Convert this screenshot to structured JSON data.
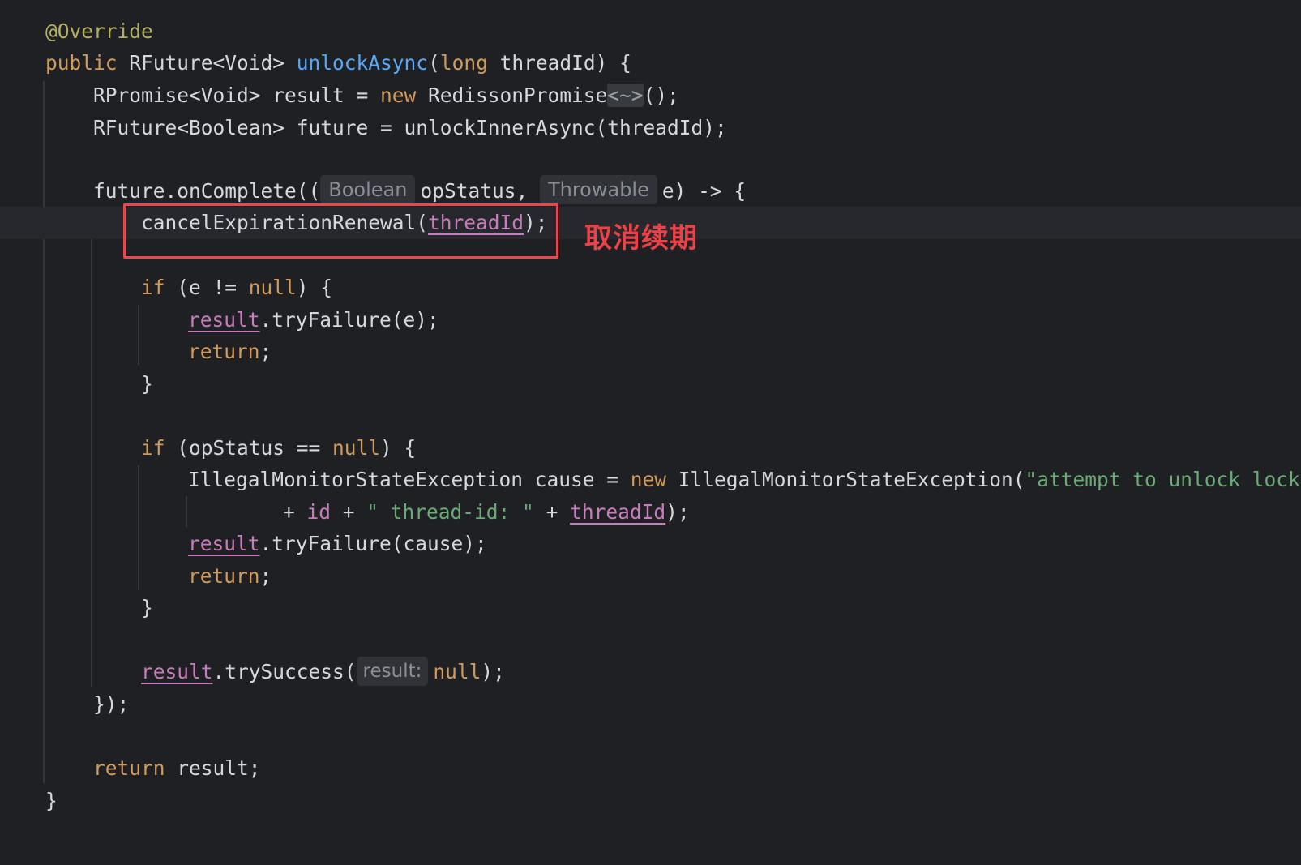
{
  "editor": {
    "lines": {
      "l1": {
        "annotation": "@Override"
      },
      "l2": {
        "kw_public": "public",
        "type": "RFuture<Void> ",
        "method": "unlockAsync",
        "paren": "(",
        "kw_long": "long",
        "rest": " threadId) {"
      },
      "l3": {
        "pre": "RPromise<Void> result = ",
        "kw_new": "new",
        "mid": " RedissonPromise",
        "diamond": "<~>",
        "post": "();"
      },
      "l4": {
        "text": "RFuture<Boolean> future = unlockInnerAsync(threadId);"
      },
      "l5": {
        "pre": "future.onComplete((",
        "hint1": "Boolean",
        "mid": "opStatus, ",
        "hint2": "Throwable",
        "post": "e) -> {"
      },
      "l6": {
        "pre": "cancelExpirationRenewal(",
        "arg": "threadId",
        "post": ");"
      },
      "l7": {
        "kw_if": "if",
        "pre": " (e != ",
        "kw_null": "null",
        "post": ") {"
      },
      "l8": {
        "var": "result",
        "post": ".tryFailure(e);"
      },
      "l9": {
        "kw_return": "return",
        "post": ";"
      },
      "l10": {
        "text": "}"
      },
      "l11": {
        "kw_if": "if",
        "pre": " (opStatus == ",
        "kw_null": "null",
        "post": ") {"
      },
      "l12": {
        "pre": "IllegalMonitorStateException cause = ",
        "kw_new": "new",
        "mid": " IllegalMonitorStateException(",
        "str": "\"attempt to unlock lock, not locked by current thread by node id: \""
      },
      "l13": {
        "pre": "+ ",
        "ref": "id",
        "mid": " + ",
        "str": "\" thread-id: \"",
        "mid2": " + ",
        "arg": "threadId",
        "post": ");"
      },
      "l14": {
        "var": "result",
        "post": ".tryFailure(cause);"
      },
      "l15": {
        "kw_return": "return",
        "post": ";"
      },
      "l16": {
        "text": "}"
      },
      "l17": {
        "var": "result",
        "pre": ".trySuccess(",
        "hint": "result:",
        "kw_null": "null",
        "post": ");"
      },
      "l18": {
        "text": "});"
      },
      "l19": {
        "kw_return": "return",
        "post": " result;"
      },
      "l20": {
        "text": "}"
      }
    },
    "callout_label": "取消续期",
    "colors": {
      "background": "#1f2024",
      "keyword": "#d19a5b",
      "function": "#56a8f5",
      "annotation": "#b3ae60",
      "string": "#6aab73",
      "field": "#c77dbb",
      "highlight_box": "#e5484d"
    }
  }
}
